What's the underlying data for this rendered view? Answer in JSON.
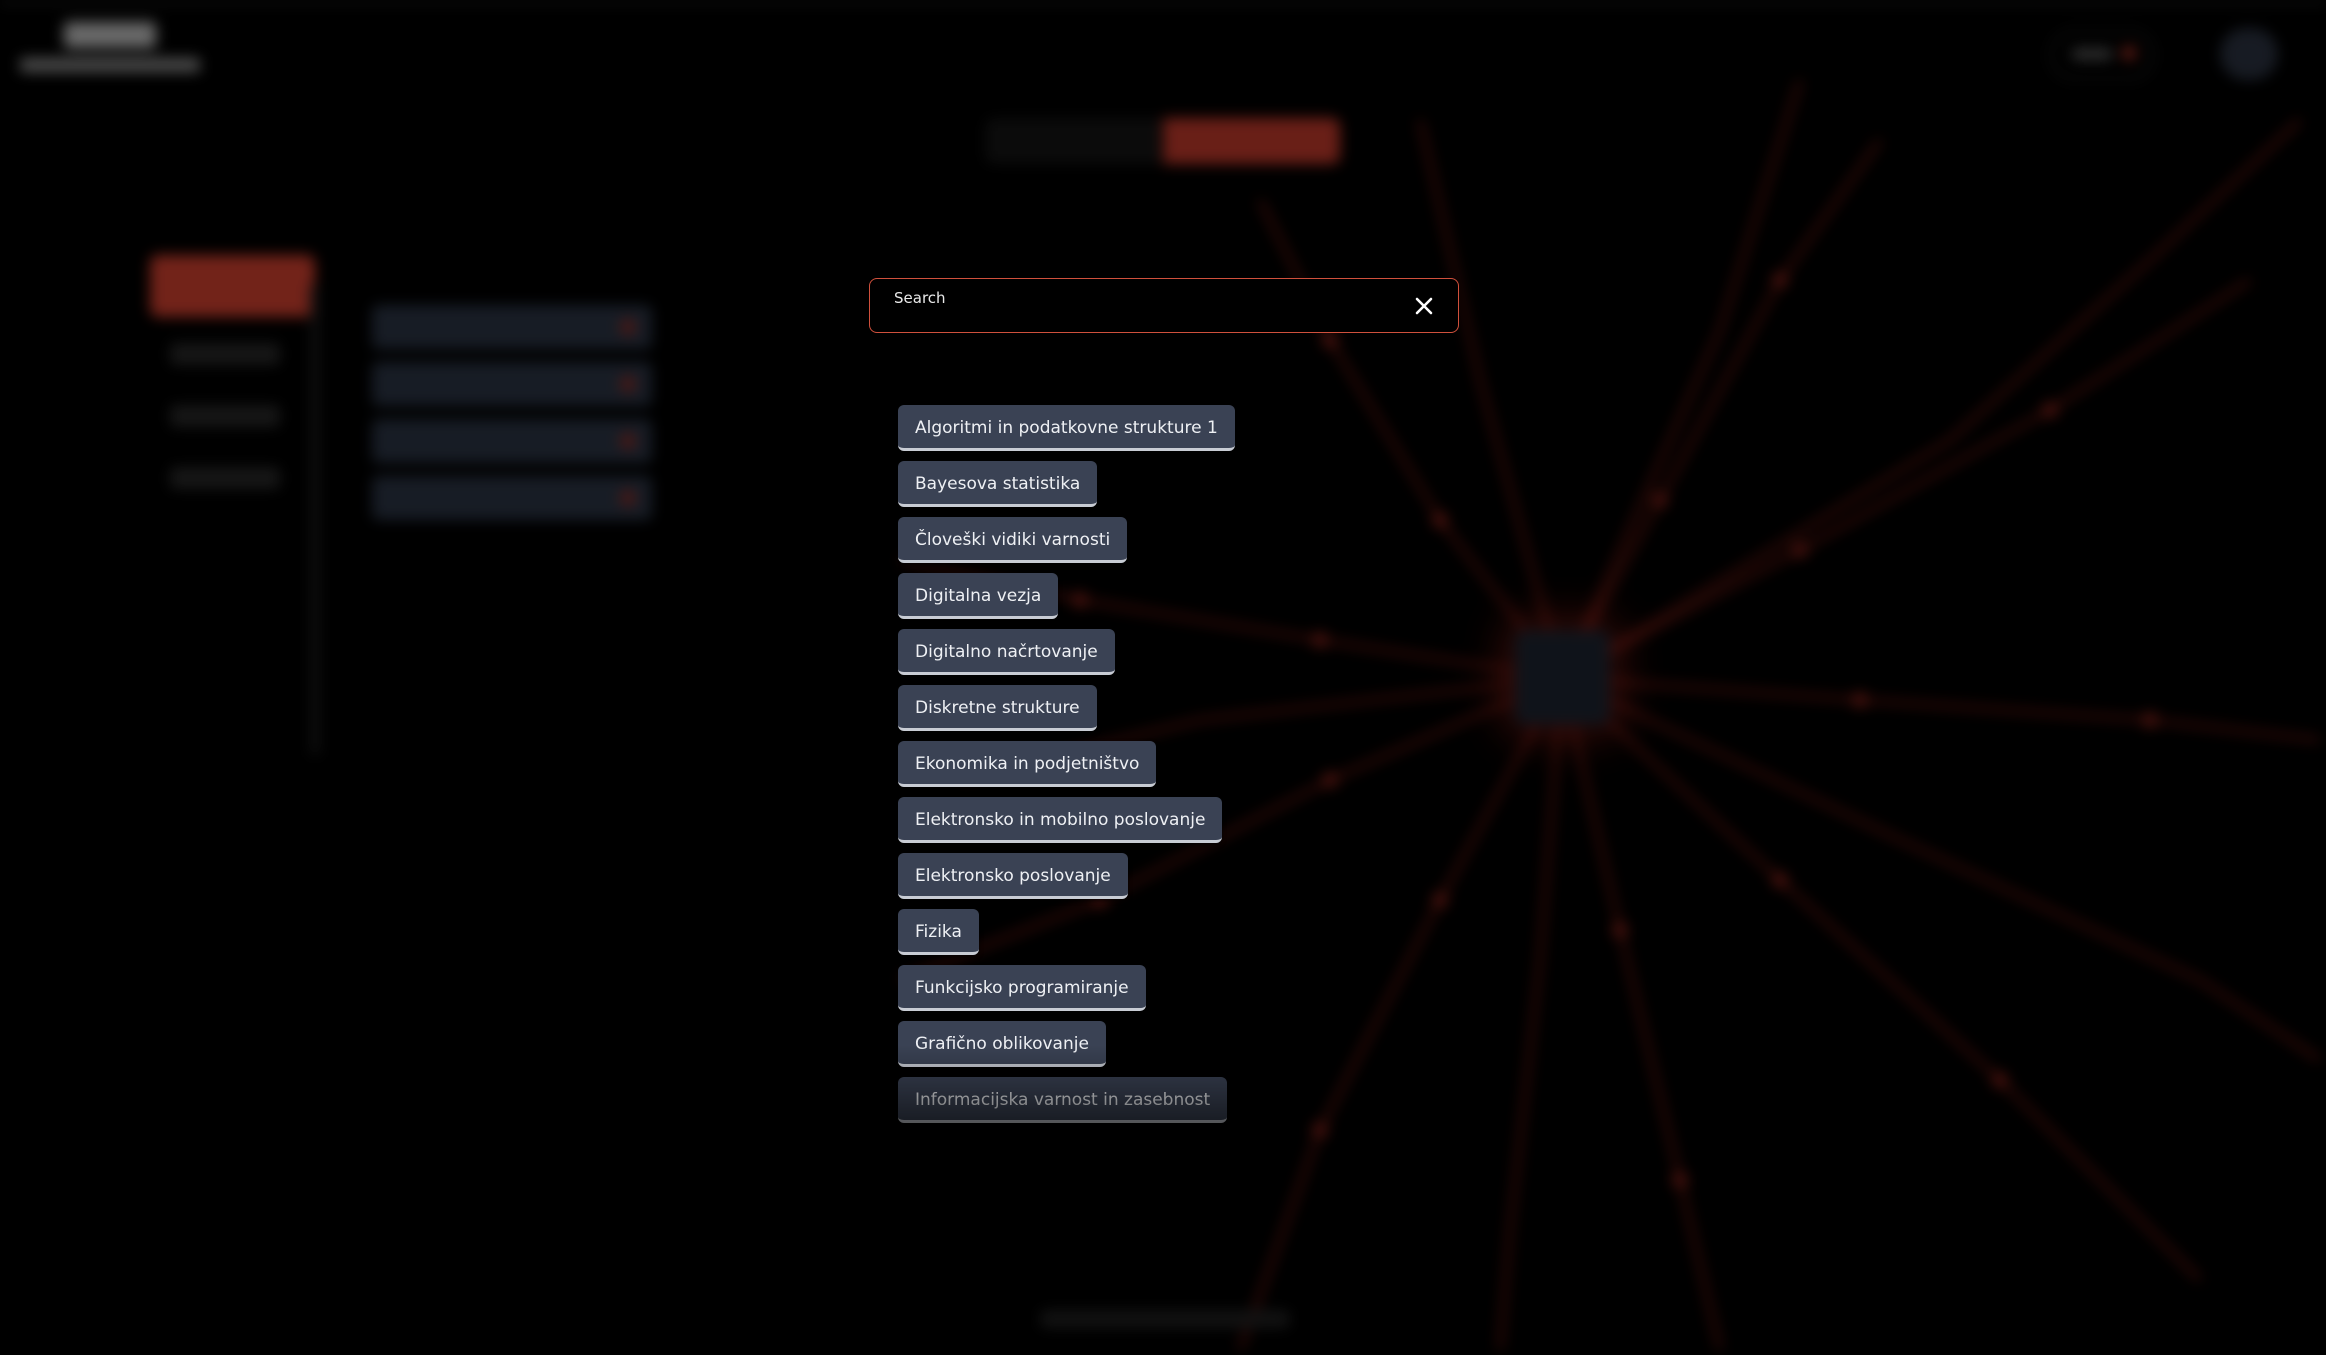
{
  "search": {
    "label": "Search",
    "value": ""
  },
  "subjects": [
    "Algoritmi in podatkovne strukture 1",
    "Bayesova statistika",
    "Človeški vidiki varnosti",
    "Digitalna vezja",
    "Digitalno načrtovanje",
    "Diskretne strukture",
    "Ekonomika in podjetništvo",
    "Elektronsko in mobilno poslovanje",
    "Elektronsko poslovanje",
    "Fizika",
    "Funkcijsko programiranje",
    "Grafično oblikovanje",
    "Informacijska varnost in zasebnost"
  ],
  "icons": {
    "close": "close-icon"
  },
  "colors": {
    "accent": "#d0503c",
    "button_bg": "#3a4254",
    "background": "#000000"
  }
}
